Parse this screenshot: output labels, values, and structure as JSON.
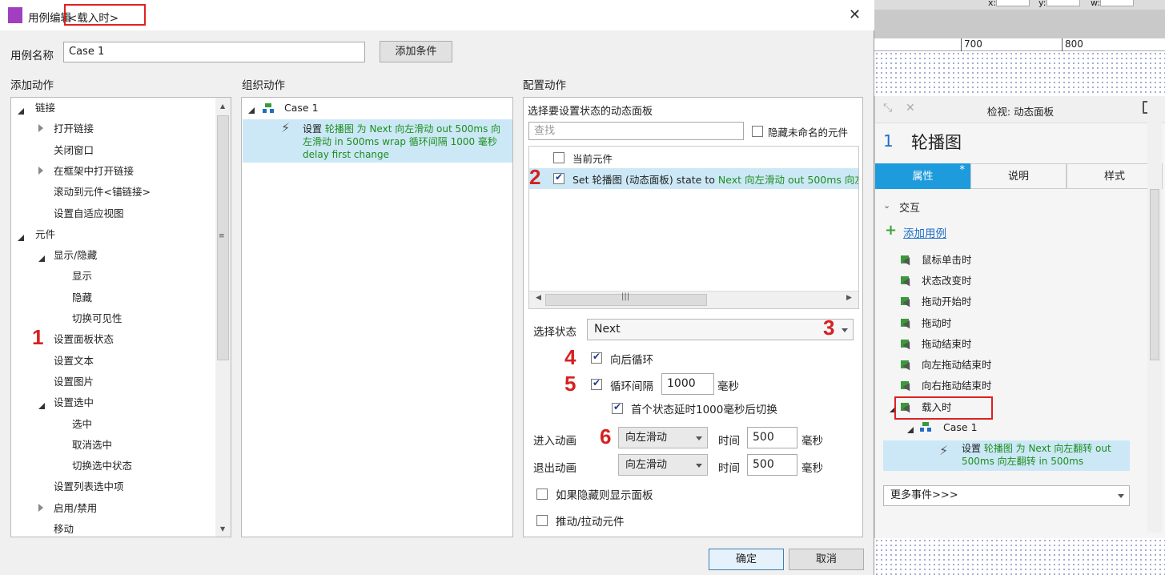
{
  "dialog": {
    "title_prefix": "用例编辑",
    "title_event": "<载入时>",
    "case_name_label": "用例名称",
    "case_name_value": "Case 1",
    "add_condition": "添加条件",
    "ok": "确定",
    "cancel": "取消"
  },
  "add_action": {
    "header": "添加动作",
    "items": [
      {
        "label": "链接",
        "level": 0,
        "expand": "open"
      },
      {
        "label": "打开链接",
        "level": 1,
        "expand": "closed"
      },
      {
        "label": "关闭窗口",
        "level": 1,
        "expand": "none"
      },
      {
        "label": "在框架中打开链接",
        "level": 1,
        "expand": "closed"
      },
      {
        "label": "滚动到元件<锚链接>",
        "level": 1,
        "expand": "none"
      },
      {
        "label": "设置自适应视图",
        "level": 1,
        "expand": "none"
      },
      {
        "label": "元件",
        "level": 0,
        "expand": "open"
      },
      {
        "label": "显示/隐藏",
        "level": 1,
        "expand": "open"
      },
      {
        "label": "显示",
        "level": 2,
        "expand": "none"
      },
      {
        "label": "隐藏",
        "level": 2,
        "expand": "none"
      },
      {
        "label": "切换可见性",
        "level": 2,
        "expand": "none"
      },
      {
        "label": "设置面板状态",
        "level": 1,
        "expand": "none"
      },
      {
        "label": "设置文本",
        "level": 1,
        "expand": "none"
      },
      {
        "label": "设置图片",
        "level": 1,
        "expand": "none"
      },
      {
        "label": "设置选中",
        "level": 1,
        "expand": "open"
      },
      {
        "label": "选中",
        "level": 2,
        "expand": "none"
      },
      {
        "label": "取消选中",
        "level": 2,
        "expand": "none"
      },
      {
        "label": "切换选中状态",
        "level": 2,
        "expand": "none"
      },
      {
        "label": "设置列表选中项",
        "level": 1,
        "expand": "none"
      },
      {
        "label": "启用/禁用",
        "level": 1,
        "expand": "closed"
      },
      {
        "label": "移动",
        "level": 1,
        "expand": "none"
      }
    ]
  },
  "organize": {
    "header": "组织动作",
    "case": "Case 1",
    "action_prefix": "设置 ",
    "action_green": "轮播图 为 Next 向左滑动 out 500ms 向左滑动 in 500ms wrap 循环间隔 1000 毫秒 delay first change"
  },
  "config": {
    "header": "配置动作",
    "select_panel_label": "选择要设置状态的动态面板",
    "search_placeholder": "查找",
    "hide_unnamed": "隐藏未命名的元件",
    "current_widget": "当前元件",
    "set_prefix": "Set 轮播图 (动态面板) state to ",
    "set_green": "Next 向左滑动 out 500ms 向左",
    "select_state_label": "选择状态",
    "select_state_value": "Next",
    "wrap_label": "向后循环",
    "interval_label": "循环间隔",
    "interval_value": "1000",
    "ms": "毫秒",
    "first_delay_label": "首个状态延时1000毫秒后切换",
    "enter_anim_label": "进入动画",
    "enter_anim_value": "向左滑动",
    "time_label": "时间",
    "enter_time": "500",
    "exit_anim_label": "退出动画",
    "exit_anim_value": "向左滑动",
    "exit_time": "500",
    "show_if_hidden": "如果隐藏则显示面板",
    "push_pull": "推动/拉动元件"
  },
  "annotations": [
    "1",
    "2",
    "3",
    "4",
    "5",
    "6"
  ],
  "canvas": {
    "toolbar": [
      "x:",
      "y:",
      "w:"
    ],
    "ruler": [
      "700",
      "800"
    ]
  },
  "inspector": {
    "title": "检视: 动态面板",
    "count": "1",
    "name": "轮播图",
    "tabs": [
      "属性",
      "说明",
      "样式"
    ],
    "tab_marker": "*",
    "section": "交互",
    "add_case": "添加用例",
    "events": [
      "鼠标单击时",
      "状态改变时",
      "拖动开始时",
      "拖动时",
      "拖动结束时",
      "向左拖动结束时",
      "向右拖动结束时",
      "载入时"
    ],
    "case": "Case 1",
    "action_prefix": "设置 ",
    "action_green": "轮播图 为 Next 向左翻转 out 500ms 向左翻转 in 500ms",
    "more_events": "更多事件>>>"
  },
  "colors": {
    "accent": "#1e9bdc",
    "annotation": "#d72020",
    "green_text": "#1e8e1e",
    "selection": "#cce8f6"
  }
}
